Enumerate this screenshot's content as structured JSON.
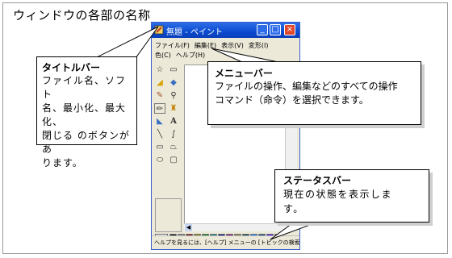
{
  "heading": "ウィンドウの各部の名称",
  "paint_window": {
    "title": "無題 - ペイント",
    "titlebar_buttons": [
      "minimize-icon",
      "maximize-icon",
      "close-icon"
    ],
    "menu_row1": [
      "ファイル(F)",
      "編集(E)",
      "表示(V)",
      "変形(I)"
    ],
    "menu_row2": [
      "色(C)",
      "ヘルプ(H)"
    ],
    "tools": [
      "select-free-icon",
      "select-rect-icon",
      "eraser-icon",
      "fill-icon",
      "picker-icon",
      "magnifier-icon",
      "pencil-icon",
      "brush-icon",
      "airbrush-icon",
      "text-icon",
      "line-icon",
      "curve-icon",
      "rectangle-icon",
      "polygon-icon",
      "ellipse-icon",
      "rounded-rect-icon"
    ],
    "text_tool_glyph": "A",
    "palette_colors": [
      "#000000",
      "#808080",
      "#800000",
      "#808000",
      "#008000",
      "#008080",
      "#000080",
      "#800080",
      "#808040",
      "#004040",
      "#0080ff",
      "#004080",
      "#4000ff",
      "#804000",
      "#ffffff",
      "#c0c0c0",
      "#ff0000",
      "#ffff00",
      "#00ff00",
      "#00ffff",
      "#0000ff",
      "#ff00ff",
      "#ffff80",
      "#00ff80",
      "#80ffff",
      "#8080ff",
      "#ff0080",
      "#ff8040"
    ],
    "status": "ヘルプを見るには、[ヘルプ] メニューの [トピックの検索"
  },
  "callouts": {
    "titlebar": {
      "title": "タイトルバー",
      "lines": [
        "ファイル名、ソフト",
        "名、最小化、最大化、",
        "閉じる のボタンがあ",
        "ります。"
      ]
    },
    "menubar": {
      "title": "メニューバー",
      "lines": [
        "ファイルの操作、編集などのすべての操作",
        "コマンド（命令）を選択できます。"
      ]
    },
    "statusbar": {
      "title": "ステータスバー",
      "lines": [
        "現在の状態を表示しま",
        "す。"
      ]
    }
  },
  "colors": {
    "titlebar": "#0a4bd0",
    "close_button": "#e0482c",
    "window_face": "#ece9d8"
  }
}
